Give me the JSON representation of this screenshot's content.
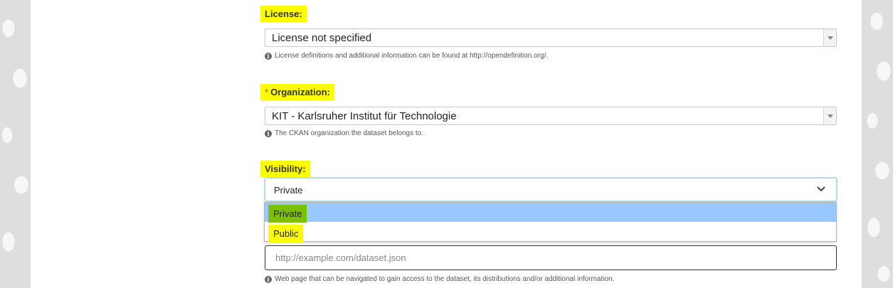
{
  "license": {
    "label": "License:",
    "value": "License not specified",
    "help": "License definitions and additional information can be found at http://opendefinition.org/."
  },
  "organization": {
    "required_mark": "*",
    "label": "Organization:",
    "value": "KIT - Karlsruher Institut für Technologie",
    "help": "The CKAN organization the dataset belongs to."
  },
  "visibility": {
    "label": "Visibility:",
    "value": "Private",
    "options": [
      "Private",
      "Public"
    ]
  },
  "url": {
    "placeholder": "http://example.com/dataset.json",
    "help": "Web page that can be navigated to gain access to the dataset, its distributions and/or additional information."
  },
  "colors": {
    "highlight": "#fffb00",
    "selected_option": "#99c8ff",
    "selected_option_marker": "#7cc000",
    "required": "#c6892c"
  }
}
